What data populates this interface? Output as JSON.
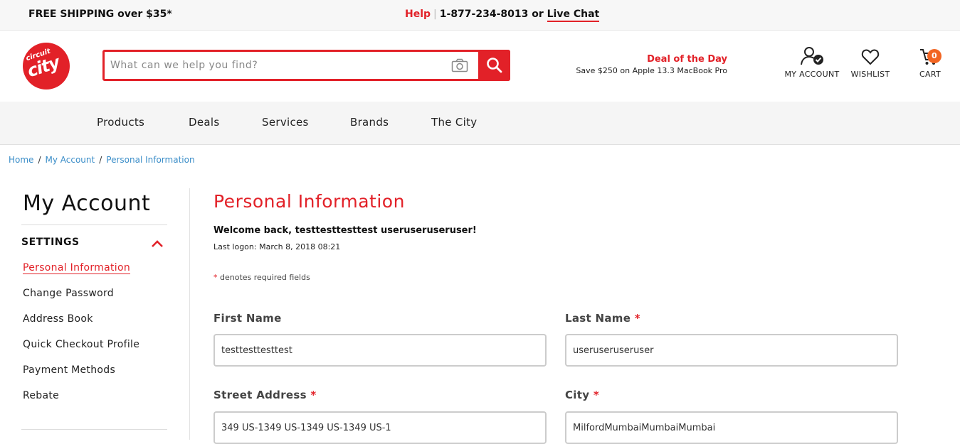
{
  "topbar": {
    "shipping": "FREE SHIPPING over $35*",
    "help": "Help",
    "phone": "1-877-234-8013 or",
    "live_chat": "Live Chat"
  },
  "logo": {
    "line1": "circuit",
    "line2": "city"
  },
  "search": {
    "placeholder": "What can we help you find?"
  },
  "deal": {
    "title": "Deal of the Day",
    "subtitle": "Save $250 on Apple 13.3 MacBook Pro"
  },
  "header_icons": {
    "account": "MY ACCOUNT",
    "wishlist": "WISHLIST",
    "cart": "CART",
    "cart_count": "0"
  },
  "nav": [
    "Products",
    "Deals",
    "Services",
    "Brands",
    "The City"
  ],
  "breadcrumb": [
    "Home",
    "My Account",
    "Personal Information"
  ],
  "sidebar": {
    "title": "My Account",
    "section": "SETTINGS",
    "items": [
      "Personal Information",
      "Change Password",
      "Address Book",
      "Quick Checkout Profile",
      "Payment Methods",
      "Rebate"
    ]
  },
  "main": {
    "title": "Personal Information",
    "welcome": "Welcome back, testtesttesttest useruseruseruser!",
    "last_logon": "Last logon: March 8, 2018 08:21",
    "required_star": "*",
    "required_note": "denotes required fields"
  },
  "form": {
    "first_name_label": "First Name",
    "first_name_value": "testtesttesttest",
    "last_name_label": "Last Name",
    "last_name_value": "useruseruseruser",
    "street_label": "Street Address",
    "street_value": "349 US-1349 US-1349 US-1349 US-1",
    "city_label": "City",
    "city_value": "MilfordMumbaiMumbaiMumbai",
    "required_star": "*"
  },
  "colors": {
    "brand_red": "#e22128",
    "link_blue": "#3a8dc8",
    "cart_badge": "#f26522"
  }
}
